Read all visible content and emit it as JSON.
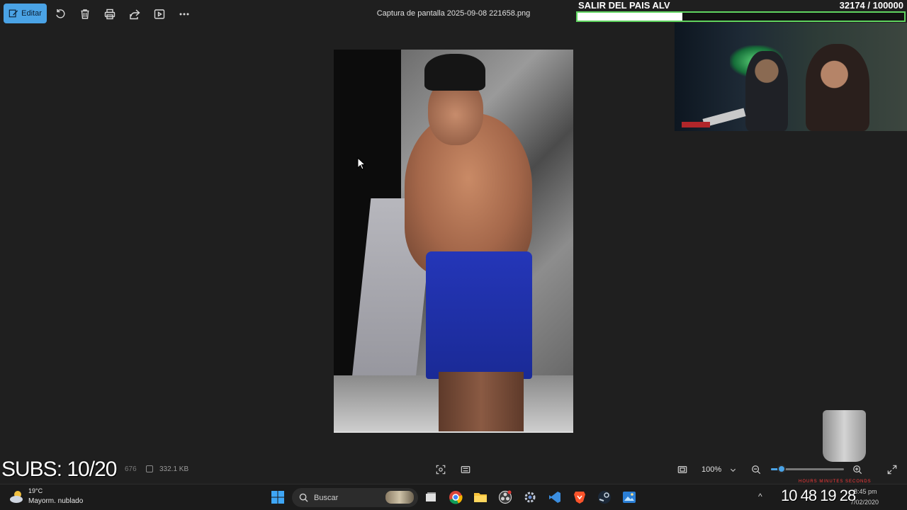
{
  "toolbar": {
    "edit_label": "Editar",
    "file_title": "Captura de pantalla 2025-09-08 221658.png",
    "icons": [
      "rotate-icon",
      "delete-icon",
      "print-icon",
      "share-icon",
      "slideshow-icon",
      "more-icon"
    ]
  },
  "stream_overlay": {
    "goal_title": "SALIR DEL PAIS ALV",
    "goal_count": "32174 / 100000",
    "goal_progress": 0.32174,
    "goal_bar_color": "#5fd35f"
  },
  "status_bar": {
    "subs_text": "SUBS: 10/20",
    "dimensions_partial": "676",
    "file_size": "332.1 KB",
    "zoom_level": "100%",
    "zoom_slider_position": 0.15
  },
  "taskbar": {
    "weather_temp": "19°C",
    "weather_desc": "Mayorm. nublado",
    "search_placeholder": "Buscar",
    "clock_overlay": "10 48 19 28",
    "clock_overlay_labels": "HOURS   MINUTES   SECONDS",
    "clock_time": "8:45 pm",
    "clock_date": "7/02/2020",
    "apps": [
      "windows-start-icon",
      "task-view-icon",
      "chrome-icon",
      "file-explorer-icon",
      "obs-icon",
      "settings-icon",
      "vscode-icon",
      "brave-icon",
      "steam-icon",
      "photos-icon"
    ]
  },
  "colors": {
    "accent": "#4aa3e6",
    "background": "#1f1f1f",
    "taskbar": "#1b1b1b"
  }
}
